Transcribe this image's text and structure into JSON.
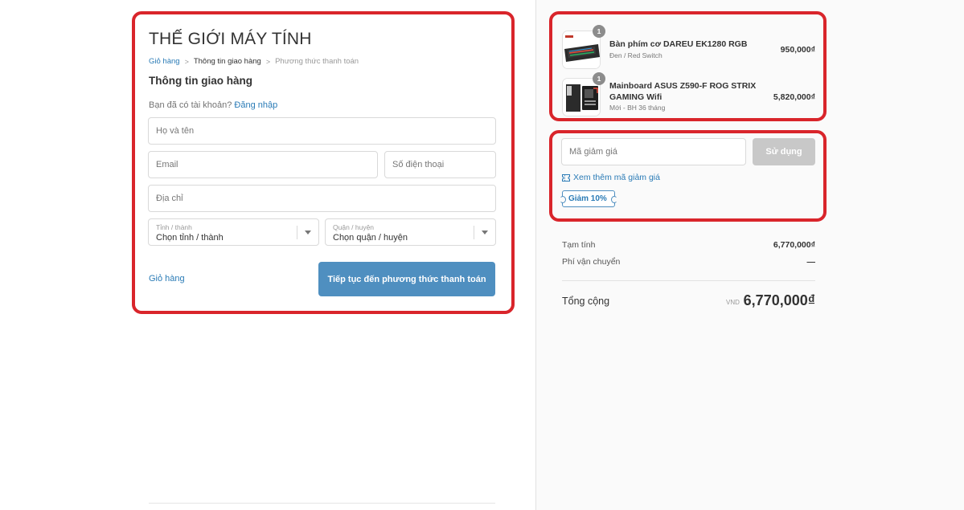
{
  "store": {
    "title": "THẾ GIỚI MÁY TÍNH"
  },
  "breadcrumb": {
    "cart": "Giỏ hàng",
    "shipping": "Thông tin giao hàng",
    "payment": "Phương thức thanh toán"
  },
  "shipping": {
    "section_title": "Thông tin giao hàng",
    "have_account": "Bạn đã có tài khoản?",
    "login_link": "Đăng nhập",
    "name_placeholder": "Họ và tên",
    "email_placeholder": "Email",
    "phone_placeholder": "Số điện thoại",
    "address_placeholder": "Địa chỉ",
    "province": {
      "label": "Tỉnh / thành",
      "value": "Chọn tỉnh / thành"
    },
    "district": {
      "label": "Quận / huyện",
      "value": "Chọn quận / huyện"
    },
    "back_link": "Giỏ hàng",
    "continue_label": "Tiếp tục đến phương thức thanh toán"
  },
  "cart": {
    "items": [
      {
        "qty": "1",
        "name": "Bàn phím cơ DAREU EK1280 RGB",
        "variant": "Đen / Red Switch",
        "price": "950,000₫"
      },
      {
        "qty": "1",
        "name": "Mainboard ASUS Z590-F ROG STRIX GAMING Wifi",
        "variant": "Mới - BH 36 tháng",
        "price": "5,820,000₫"
      }
    ]
  },
  "discount": {
    "placeholder": "Mã giảm giá",
    "apply_label": "Sử dụng",
    "more_codes": "Xem thêm mã giảm giá",
    "coupon_chip": "Giảm 10%"
  },
  "summary": {
    "subtotal_label": "Tạm tính",
    "subtotal_value": "6,770,000₫",
    "shipping_label": "Phí vận chuyển",
    "shipping_value": "—",
    "total_label": "Tổng cộng",
    "currency": "VND",
    "total_value": "6,770,000₫"
  },
  "colors": {
    "accent": "#2a7bb6",
    "button": "#4f8fc0",
    "highlight": "#d9252b"
  }
}
